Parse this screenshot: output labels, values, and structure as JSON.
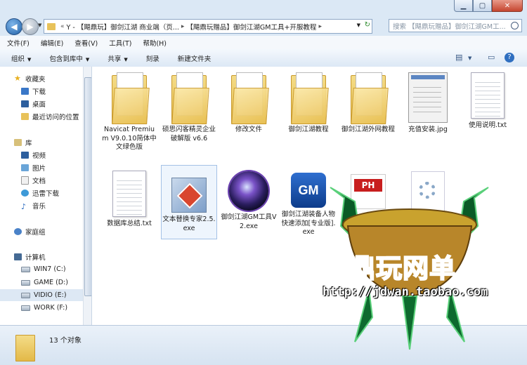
{
  "address": {
    "crumbs": [
      "Y - 【飓鼎玩】御剑江湖 商业端（页...",
      "【飓鼎玩赠品】御剑江湖GM工具+开服教程"
    ]
  },
  "search": {
    "placeholder": "搜索 【飓鼎玩赠品】御剑江湖GM工..."
  },
  "menu": [
    "文件(F)",
    "编辑(E)",
    "查看(V)",
    "工具(T)",
    "帮助(H)"
  ],
  "toolbar": {
    "organize": "组织",
    "include": "包含到库中",
    "share": "共享",
    "burn": "刻录",
    "new_folder": "新建文件夹"
  },
  "sidebar": {
    "favorites": "收藏夹",
    "downloads": "下载",
    "desktop": "桌面",
    "recent": "最近访问的位置",
    "libraries": "库",
    "videos": "视频",
    "pictures": "图片",
    "documents": "文档",
    "thunder": "迅雷下载",
    "music": "音乐",
    "homegroup": "家庭组",
    "computer": "计算机",
    "drives": [
      "WIN7 (C:)",
      "GAME (D:)",
      "VIDIO (E:)",
      "WORK (F:)"
    ]
  },
  "files": [
    "Navicat Premium V9.0.10简体中文绿色版",
    "硕思闪客精灵企业破解版 v6.6",
    "修改文件",
    "御剑江湖教程",
    "御剑江湖外网教程",
    "充值安装.jpg",
    "使用说明.txt",
    "数据库总结.txt",
    "文本替换专家2.5.exe",
    "御剑江湖GM工具V2.exe",
    "御剑江湖装备人物快速添加[专业版].exe",
    "主",
    ""
  ],
  "status": {
    "count": "13 个对象"
  },
  "watermark": {
    "title": "飓鼎玩网单",
    "url": "http://jdwan.taobao.com"
  }
}
